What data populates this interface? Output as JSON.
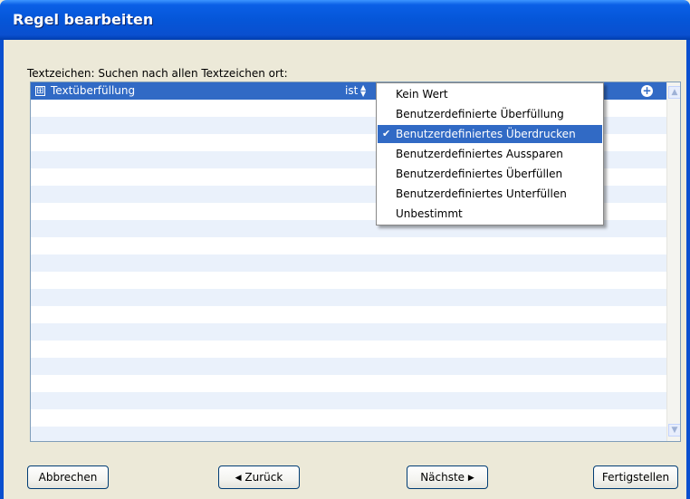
{
  "window": {
    "title": "Regel bearbeiten"
  },
  "prompt": {
    "label": "Textzeichen: Suchen nach allen Textzeichen ort:"
  },
  "rule_row": {
    "expander": "⊞",
    "field": "Textüberfüllung",
    "operator": "ist",
    "operator_arrows": "▲▼",
    "add_icon": "+"
  },
  "dropdown": {
    "items": [
      {
        "label": "Kein Wert",
        "selected": false
      },
      {
        "label": "Benutzerdefinierte Überfüllung",
        "selected": false
      },
      {
        "label": "Benutzerdefiniertes Überdrucken",
        "selected": true
      },
      {
        "label": "Benutzerdefiniertes Aussparen",
        "selected": false
      },
      {
        "label": "Benutzerdefiniertes Überfüllen",
        "selected": false
      },
      {
        "label": "Benutzerdefiniertes Unterfüllen",
        "selected": false
      },
      {
        "label": "Unbestimmt",
        "selected": false
      }
    ],
    "check": "✔"
  },
  "buttons": {
    "cancel": "Abbrechen",
    "back": "Zurück",
    "next": "Nächste",
    "finish": "Fertigstellen"
  },
  "colors": {
    "titlebar": "#0556d8",
    "selection": "#316ac5",
    "row_alt": "#eaf1fb",
    "window_bg": "#ece9d8"
  }
}
